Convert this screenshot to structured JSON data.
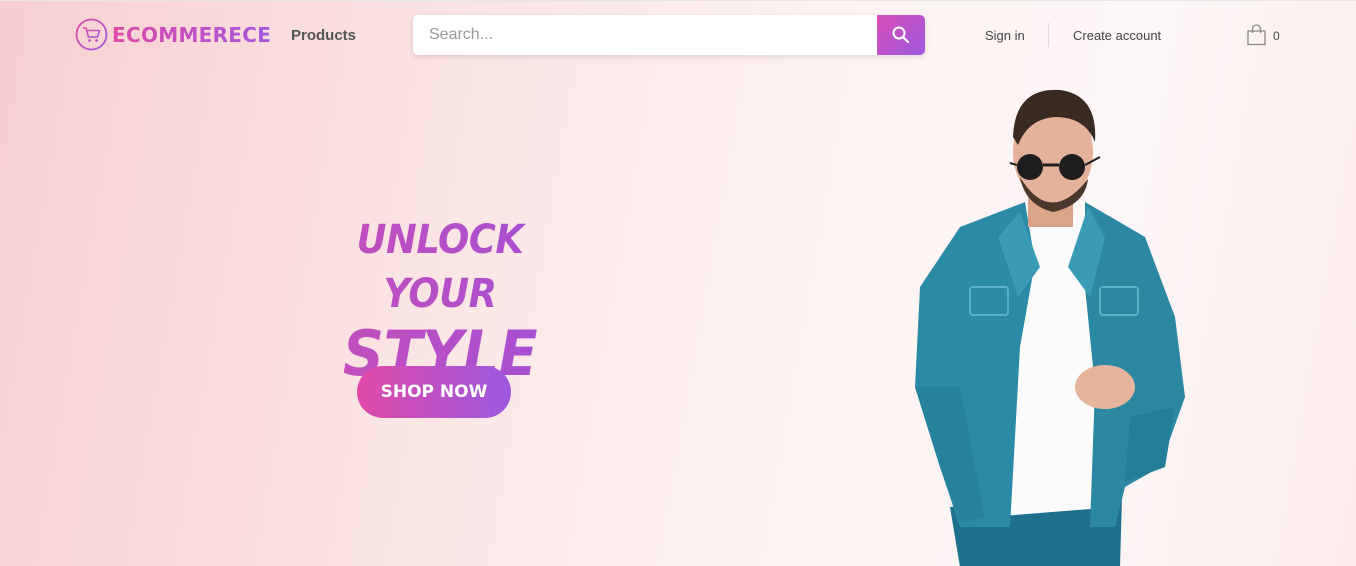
{
  "brand": {
    "name": "ECOMMERECE",
    "accent_start": "#e04aa8",
    "accent_end": "#9c58e0"
  },
  "nav": {
    "products": "Products"
  },
  "search": {
    "placeholder": "Search...",
    "icon": "search-icon"
  },
  "account": {
    "sign_in": "Sign in",
    "create_account": "Create account"
  },
  "cart": {
    "icon": "shopping-bag-icon",
    "count": "0"
  },
  "hero": {
    "line1": "UNLOCK YOUR",
    "line2": "STYLE",
    "cta": "SHOP NOW"
  },
  "colors": {
    "hero_bg_left": "#f6cfd0",
    "hero_bg_right": "#fdf6f6",
    "text_dark": "#444444"
  }
}
